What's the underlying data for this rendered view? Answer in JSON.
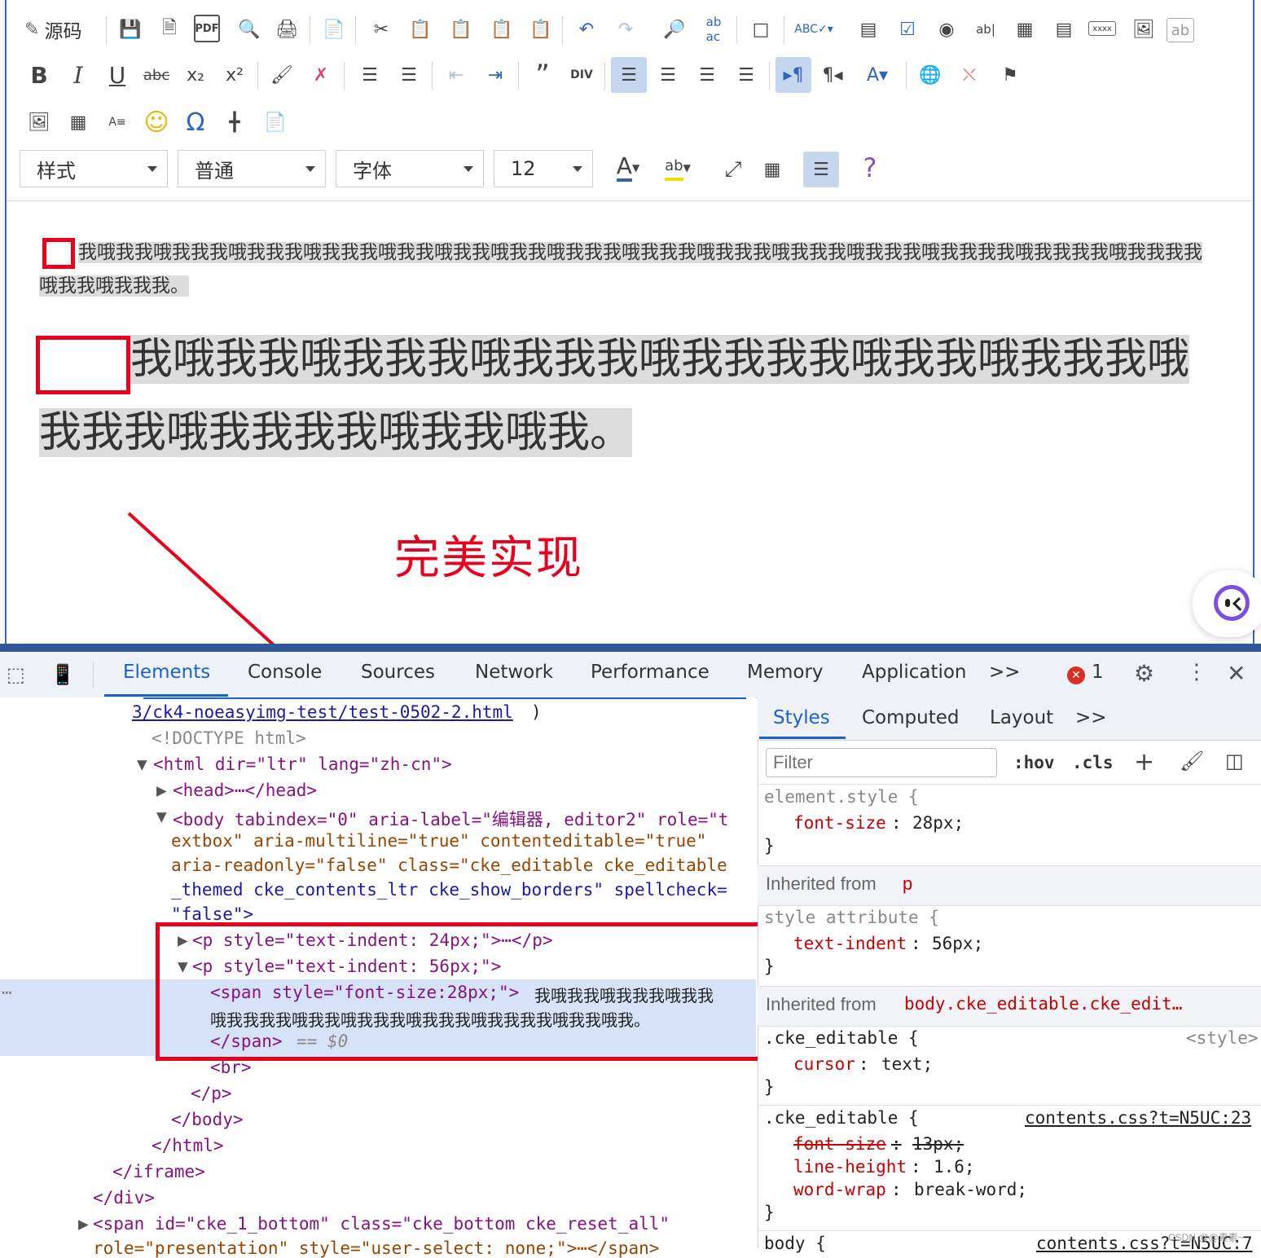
{
  "toolbar": {
    "source_label": "源码",
    "styles_combo": "样式",
    "format_combo": "普通",
    "font_combo": "字体",
    "size_combo": "12",
    "help": "?"
  },
  "content": {
    "para1": "我哦我我哦我我我哦我我我哦我我我哦我我哦我我哦我我哦我我我哦我我我哦我我我哦我我我哦我我我哦我我我我哦我我我我哦我我我我哦我我哦我我我。",
    "para2": "我哦我我哦我我我哦我我我哦我我我我哦我我哦我我我哦我我我哦我我我我哦我我哦我。",
    "annotation": "完美实现"
  },
  "devtools": {
    "tabs": [
      "Elements",
      "Console",
      "Sources",
      "Network",
      "Performance",
      "Memory",
      "Application"
    ],
    "active_tab": "Elements",
    "more": ">>",
    "error_count": "1",
    "dom": {
      "url": "3/ck4-noeasyimg-test/test-0502-2.html",
      "url_close": ")",
      "doctype": "<!DOCTYPE html>",
      "html_open": "<html dir=\"ltr\" lang=\"zh-cn\">",
      "head": "<head>⋯</head>",
      "body_line1": "<body tabindex=\"0\" aria-label=\"编辑器, editor2\" role=\"t",
      "body_line2": "extbox\" aria-multiline=\"true\" contenteditable=\"true\"",
      "body_line3": "aria-readonly=\"false\" class=\"cke_editable cke_editable",
      "body_line4": "_themed cke_contents_ltr cke_show_borders\" spellcheck=",
      "body_line5": "\"false\">",
      "p1": "<p style=\"text-indent: 24px;\">⋯</p>",
      "p2": "<p style=\"text-indent: 56px;\">",
      "span_open": "<span style=\"font-size:28px;\">",
      "span_text1": "我哦我我哦我我我哦我我",
      "span_text2": "哦我我我我哦我我哦我我我哦我我我哦我我我我哦我我哦我。",
      "span_close": "</span>",
      "span_dollar": "== $0",
      "br": "<br>",
      "p_close": "</p>",
      "body_close": "</body>",
      "html_close": "</html>",
      "iframe_close": "</iframe>",
      "div_close": "</div>",
      "span_bottom": "<span id=\"cke_1_bottom\" class=\"cke_bottom cke_reset_all\"",
      "span_bottom2": "role=\"presentation\" style=\"user-select: none;\">⋯</span>"
    },
    "styles": {
      "tabs": [
        "Styles",
        "Computed",
        "Layout"
      ],
      "more": ">>",
      "filter_placeholder": "Filter",
      "hov": ":hov",
      "cls": ".cls",
      "rule1_selector": "element.style {",
      "rule1_prop": "font-size",
      "rule1_val": "28px;",
      "close": "}",
      "inherited_p": "Inherited from",
      "inherited_p_tag": "p",
      "rule2_selector": "style attribute {",
      "rule2_prop": "text-indent",
      "rule2_val": "56px;",
      "inherited_body": "Inherited from",
      "inherited_body_tag": "body.cke_editable.cke_edit…",
      "rule3_selector": ".cke_editable {",
      "rule3_source": "<style>",
      "rule3_prop": "cursor",
      "rule3_val": "text;",
      "rule4_selector": ".cke_editable {",
      "rule4_source": "contents.css?t=N5UC:23",
      "rule4_prop1": "font-size",
      "rule4_val1": "13px;",
      "rule4_prop2": "line-height",
      "rule4_val2": "1.6;",
      "rule4_prop3": "word-wrap",
      "rule4_val3": "break-word;",
      "rule5_selector": "body {",
      "rule5_source": "contents.css?t=N5UC:7"
    }
  },
  "watermark": "CSDN @@素素~",
  "colors": {
    "accent": "#1a63c7",
    "annotation_red": "#e8001c",
    "editor_border": "#3866b4",
    "highlight": "#dcdcdc"
  }
}
